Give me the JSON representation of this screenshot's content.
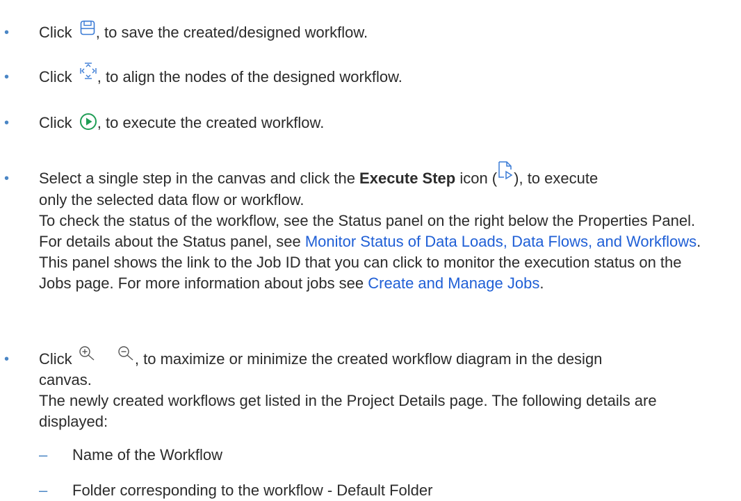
{
  "bullet_char": "•",
  "dash_char": "–",
  "colors": {
    "bullet": "#4a86c5",
    "link": "#1f5fd6",
    "text": "#2b2b2b",
    "play_icon": "#1f9d55",
    "toolbar_icon": "#3a7bd5"
  },
  "items": [
    {
      "prefix": "Click",
      "icon": "save-icon",
      "suffix": ", to save the created/designed workflow."
    },
    {
      "prefix": "Click",
      "icon": "align-nodes-icon",
      "suffix": ", to align the nodes of the designed workflow."
    },
    {
      "prefix": "Click",
      "icon": "play-icon",
      "suffix": ", to execute the created workflow."
    },
    {
      "line1_prefix": "Select a single step in the canvas and click the ",
      "line1_bold": "Execute Step",
      "line1_mid": " icon (",
      "icon": "execute-step-icon",
      "line1_suffix": "), to execute",
      "line2": "only the selected data flow or workflow.",
      "para_a": "To check the status of the workflow, see the Status panel on the right below the Properties Panel. For details about the Status panel, see ",
      "link1": "Monitor Status of Data Loads, Data Flows, and Workflows",
      "para_b": ". This panel shows the link to the Job ID that you can click to monitor the execution status on the Jobs page. For more information about jobs see ",
      "link2": "Create and Manage Jobs",
      "para_c": "."
    },
    {
      "prefix": "Click",
      "icon_zoom_in": "zoom-in-icon",
      "icon_zoom_out": "zoom-out-icon",
      "suffix": ", to maximize or minimize the created workflow diagram in the design",
      "line2": "canvas.",
      "para": "The newly created workflows get listed in the Project Details page. The following details are displayed:"
    }
  ],
  "sub_items": [
    "Name of the Workflow",
    "Folder corresponding to the workflow - Default Folder"
  ]
}
